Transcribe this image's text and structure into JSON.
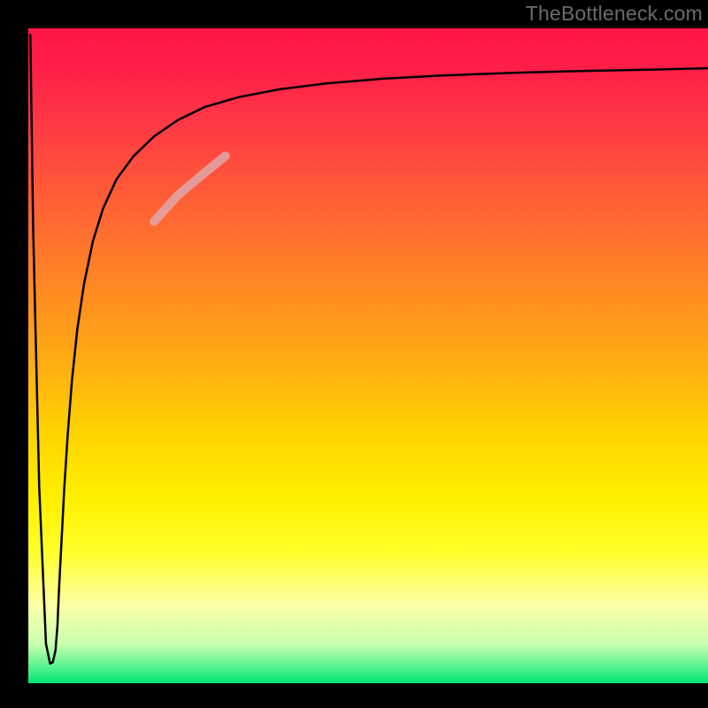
{
  "watermark": "TheBottleneck.com",
  "chart_data": {
    "type": "line",
    "title": "",
    "xlabel": "",
    "ylabel": "",
    "xlim": [
      0,
      100
    ],
    "ylim": [
      0,
      100
    ],
    "grid": false,
    "legend": false,
    "background_gradient": {
      "top": "#ff1646",
      "mid": "#ffff2a",
      "bottom": "#00e472"
    },
    "series": [
      {
        "name": "curve",
        "color": "#000000",
        "width": 2.5,
        "x": [
          0.3,
          0.7,
          1.6,
          2.6,
          3.2,
          3.6,
          4.0,
          4.3,
          4.5,
          4.9,
          5.3,
          5.8,
          6.4,
          7.2,
          8.2,
          9.5,
          11.0,
          13.0,
          15.5,
          18.5,
          22.0,
          26.0,
          31.0,
          37.0,
          44.0,
          52.0,
          61.0,
          71.0,
          82.0,
          92.0,
          100.0
        ],
        "y": [
          99.0,
          70.0,
          30.0,
          6.0,
          3.0,
          3.2,
          5.0,
          9.0,
          14.0,
          22.0,
          30.0,
          38.0,
          46.0,
          54.0,
          61.0,
          67.5,
          72.5,
          77.0,
          80.5,
          83.5,
          86.0,
          88.0,
          89.5,
          90.7,
          91.6,
          92.3,
          92.8,
          93.2,
          93.5,
          93.7,
          93.9
        ]
      },
      {
        "name": "highlight-segment",
        "color": "#e0a7a7",
        "width": 10,
        "opacity": 0.85,
        "x": [
          18.5,
          22.0,
          26.0,
          29.0
        ],
        "y": [
          70.5,
          74.5,
          78.0,
          80.5
        ]
      }
    ]
  }
}
